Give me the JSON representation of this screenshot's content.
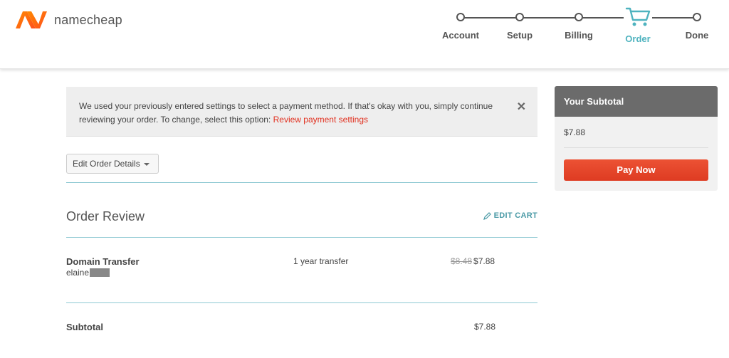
{
  "brand": {
    "name": "namecheap",
    "accent": "#ff6600"
  },
  "steps": [
    {
      "label": "Account",
      "active": false
    },
    {
      "label": "Setup",
      "active": false
    },
    {
      "label": "Billing",
      "active": false
    },
    {
      "label": "Order",
      "active": true
    },
    {
      "label": "Done",
      "active": false
    }
  ],
  "notice": {
    "text": "We used your previously entered settings to select a payment method. If that's okay with you, simply continue reviewing your order. To change, select this option: ",
    "link": "Review payment settings",
    "close_icon": "close-icon"
  },
  "edit_order": {
    "label": "Edit Order Details"
  },
  "order_review": {
    "title": "Order Review",
    "edit_cart": "EDIT CART",
    "item": {
      "name": "Domain Transfer",
      "sub": "elaine",
      "term": "1 year transfer",
      "old_price": "$8.48",
      "price": "$7.88"
    },
    "subtotal_label": "Subtotal",
    "subtotal_value": "$7.88"
  },
  "sidebar": {
    "title": "Your Subtotal",
    "amount": "$7.88",
    "pay_button": "Pay Now"
  }
}
